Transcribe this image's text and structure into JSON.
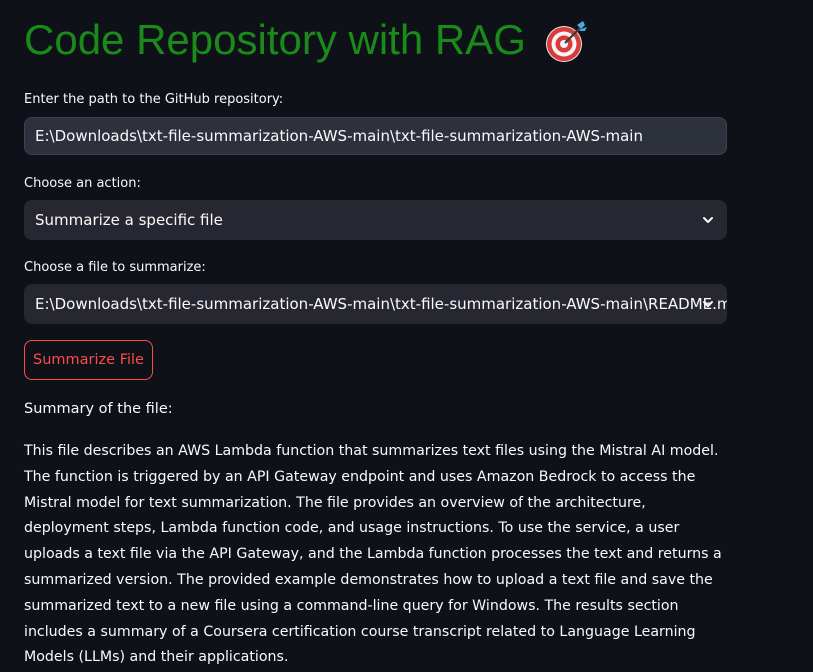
{
  "header": {
    "title": "Code Repository with RAG",
    "icon": "target-icon"
  },
  "repo_path": {
    "label": "Enter the path to the GitHub repository:",
    "value": "E:\\Downloads\\txt-file-summarization-AWS-main\\txt-file-summarization-AWS-main"
  },
  "action": {
    "label": "Choose an action:",
    "selected": "Summarize a specific file"
  },
  "file_select": {
    "label": "Choose a file to summarize:",
    "selected": "E:\\Downloads\\txt-file-summarization-AWS-main\\txt-file-summarization-AWS-main\\README.md"
  },
  "button": {
    "label": "Summarize File"
  },
  "summary": {
    "heading": "Summary of the file:",
    "text": "This file describes an AWS Lambda function that summarizes text files using the Mistral AI model. The function is triggered by an API Gateway endpoint and uses Amazon Bedrock to access the Mistral model for text summarization. The file provides an overview of the architecture, deployment steps, Lambda function code, and usage instructions. To use the service, a user uploads a text file via the API Gateway, and the Lambda function processes the text and returns a summarized version. The provided example demonstrates how to upload a text file and save the summarized text to a new file using a command-line query for Windows. The results section includes a summary of a Coursera certification course transcript related to Language Learning Models (LLMs) and their applications."
  },
  "colors": {
    "background": "#0e1117",
    "title": "#1a8a1a",
    "accent": "#ff4b4b",
    "field": "#262730"
  }
}
